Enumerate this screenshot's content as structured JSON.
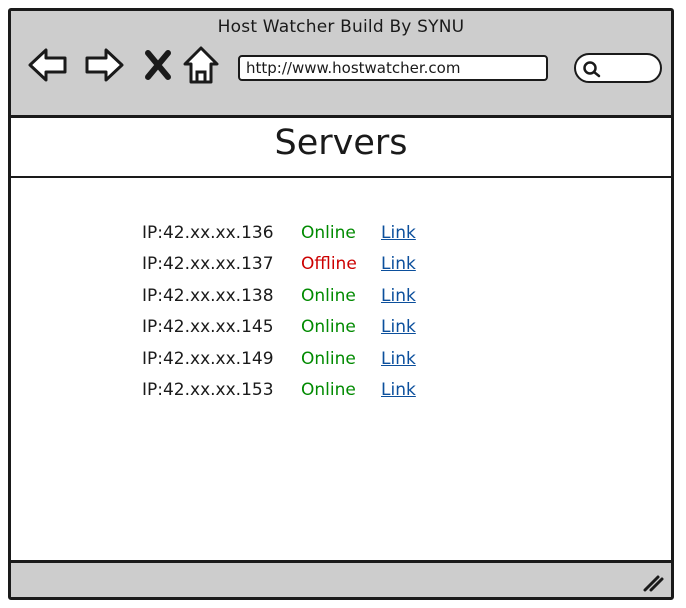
{
  "window": {
    "title": "Host Watcher Build By SYNU"
  },
  "toolbar": {
    "back_icon": "back-arrow-icon",
    "forward_icon": "forward-arrow-icon",
    "stop_icon": "close-icon",
    "home_icon": "home-icon",
    "address": "http://www.hostwatcher.com",
    "search_placeholder": "",
    "search_icon": "search-icon"
  },
  "page": {
    "title": "Servers"
  },
  "servers": [
    {
      "ip": "IP:42.xx.xx.136",
      "status": "Online",
      "link": "Link"
    },
    {
      "ip": "IP:42.xx.xx.137",
      "status": "Offline",
      "link": "Link"
    },
    {
      "ip": "IP:42.xx.xx.138",
      "status": "Online",
      "link": "Link"
    },
    {
      "ip": "IP:42.xx.xx.145",
      "status": "Online",
      "link": "Link"
    },
    {
      "ip": "IP:42.xx.xx.149",
      "status": "Online",
      "link": "Link"
    },
    {
      "ip": "IP:42.xx.xx.153",
      "status": "Online",
      "link": "Link"
    }
  ],
  "colors": {
    "online": "#008a00",
    "offline": "#cc0000",
    "link": "#0b4f9c",
    "chrome": "#cdcdcd"
  },
  "footer": {
    "resize_icon": "resize-grip-icon"
  }
}
